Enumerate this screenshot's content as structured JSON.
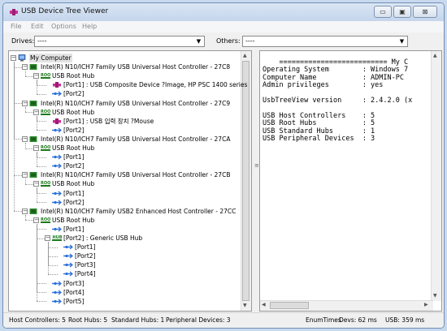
{
  "window": {
    "title": "USB Device Tree Viewer",
    "controls": {
      "minimize": "▭",
      "maximize": "▣",
      "close": "⊠"
    }
  },
  "menu": [
    "File",
    "Edit",
    "Options",
    "Help"
  ],
  "toolbar": {
    "drives_label": "Drives:",
    "drives_value": "----",
    "others_label": "Others:",
    "others_value": "----"
  },
  "tree": [
    {
      "level": 0,
      "icon": "computer-icon",
      "expander": "minus",
      "label": "My Computer"
    },
    {
      "level": 1,
      "icon": "controller-icon",
      "expander": "minus",
      "label": "Intel(R) N10/ICH7 Family USB Universal Host Controller - 27C8"
    },
    {
      "level": 2,
      "icon": "roothub-icon",
      "expander": "minus",
      "label": "USB Root Hub"
    },
    {
      "level": 3,
      "icon": "device-icon",
      "expander": "none",
      "label": "[Port1] : USB Composite Device ?Image, HP PSC 1400 series"
    },
    {
      "level": 3,
      "icon": "port-icon",
      "expander": "none",
      "label": "[Port2]"
    },
    {
      "level": 1,
      "icon": "controller-icon",
      "expander": "minus",
      "label": "Intel(R) N10/ICH7 Family USB Universal Host Controller - 27C9"
    },
    {
      "level": 2,
      "icon": "roothub-icon",
      "expander": "minus",
      "label": "USB Root Hub"
    },
    {
      "level": 3,
      "icon": "device-icon",
      "expander": "none",
      "label": "[Port1] : USB 입력 장치 ?Mouse"
    },
    {
      "level": 3,
      "icon": "port-icon",
      "expander": "none",
      "label": "[Port2]"
    },
    {
      "level": 1,
      "icon": "controller-icon",
      "expander": "minus",
      "label": "Intel(R) N10/ICH7 Family USB Universal Host Controller - 27CA"
    },
    {
      "level": 2,
      "icon": "roothub-icon",
      "expander": "minus",
      "label": "USB Root Hub"
    },
    {
      "level": 3,
      "icon": "port-icon",
      "expander": "none",
      "label": "[Port1]"
    },
    {
      "level": 3,
      "icon": "port-icon",
      "expander": "none",
      "label": "[Port2]"
    },
    {
      "level": 1,
      "icon": "controller-icon",
      "expander": "minus",
      "label": "Intel(R) N10/ICH7 Family USB Universal Host Controller - 27CB"
    },
    {
      "level": 2,
      "icon": "roothub-icon",
      "expander": "minus",
      "label": "USB Root Hub"
    },
    {
      "level": 3,
      "icon": "port-icon",
      "expander": "none",
      "label": "[Port1]"
    },
    {
      "level": 3,
      "icon": "port-icon",
      "expander": "none",
      "label": "[Port2]"
    },
    {
      "level": 1,
      "icon": "controller-icon",
      "expander": "minus",
      "label": "Intel(R) N10/ICH7 Family USB2 Enhanced Host Controller - 27CC"
    },
    {
      "level": 2,
      "icon": "roothub-icon",
      "expander": "minus",
      "label": "USB Root Hub"
    },
    {
      "level": 3,
      "icon": "port-icon",
      "expander": "none",
      "label": "[Port1]"
    },
    {
      "level": 3,
      "icon": "hub-icon",
      "expander": "minus",
      "label": "[Port2] : Generic USB Hub"
    },
    {
      "level": 4,
      "icon": "port-icon",
      "expander": "none",
      "label": "[Port1]"
    },
    {
      "level": 4,
      "icon": "port-icon",
      "expander": "none",
      "label": "[Port2]"
    },
    {
      "level": 4,
      "icon": "port-icon",
      "expander": "none",
      "label": "[Port3]"
    },
    {
      "level": 4,
      "icon": "port-icon",
      "expander": "none",
      "label": "[Port4]"
    },
    {
      "level": 3,
      "icon": "port-icon",
      "expander": "none",
      "label": "[Port3]"
    },
    {
      "level": 3,
      "icon": "port-icon",
      "expander": "none",
      "label": "[Port4]"
    },
    {
      "level": 3,
      "icon": "port-icon",
      "expander": "none",
      "label": "[Port5]"
    }
  ],
  "info_text": "    ========================== My C\nOperating System        : Windows 7\nComputer Name           : ADMIN-PC\nAdmin privileges        : yes\n\nUsbTreeView version     : 2.4.2.0 (x\n\nUSB Host Controllers    : 5\nUSB Root Hubs           : 5\nUSB Standard Hubs       : 1\nUSB Peripheral Devices  : 3",
  "status": {
    "host_controllers": "Host Controllers: 5",
    "root_hubs": "Root Hubs: 5",
    "standard_hubs": "Standard Hubs: 1",
    "peripheral_devices": "Peripheral Devices: 3",
    "enum_times": "EnumTimes",
    "devs": "Devs: 62 ms",
    "usb": "USB: 359 ms"
  },
  "colors": {
    "controller": "#2e8b2e",
    "port": "#2b6fd6",
    "device": "#cc2f9a",
    "hub": "#1a7a1a"
  }
}
